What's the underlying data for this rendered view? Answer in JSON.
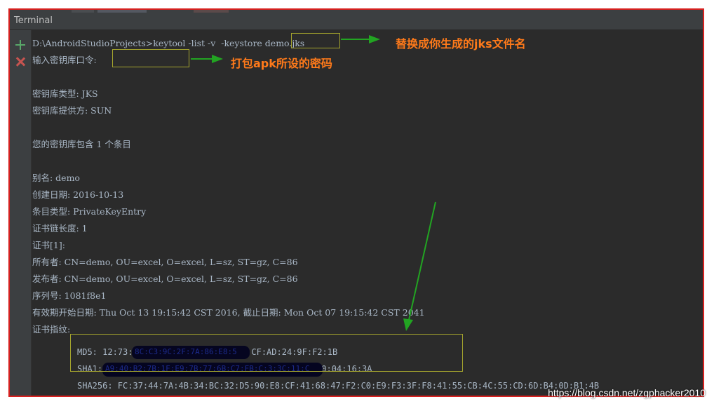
{
  "window": {
    "title": "Terminal"
  },
  "console": {
    "command_prefix": "D:\\AndroidStudioProjects>keytool -list -v  -keystore ",
    "command_file": "demo.jks",
    "password_prompt": "输入密钥库口令:",
    "keystore_type": "密钥库类型: JKS",
    "keystore_provider": "密钥库提供方: SUN",
    "entry_count": "您的密钥库包含 1 个条目",
    "alias": "别名: demo",
    "creation_date": "创建日期: 2016-10-13",
    "entry_type": "条目类型: PrivateKeyEntry",
    "chain_length": "证书链长度: 1",
    "cert_index": "证书[1]:",
    "owner": "所有者: CN=demo, OU=excel, O=excel, L=sz, ST=gz, C=86",
    "issuer": "发布者: CN=demo, OU=excel, O=excel, L=sz, ST=gz, C=86",
    "serial": "序列号: 1081f8e1",
    "validity": "有效期开始日期: Thu Oct 13 19:15:42 CST 2016, 截止日期: Mon Oct 07 19:15:42 CST 2041",
    "fingerprints_label": "证书指纹:",
    "md5_prefix": "MD5: 12:73:",
    "md5_suffix": ":54:CF:AD:24:9F:F2:1B",
    "md5_redacted": "8C:C3:9C:2F:7A:86:E8:5",
    "sha1_prefix": "SHA1:",
    "sha1_redacted": "A9:40:B2:7B:1F:E9:7B:77:6B:C7:FB:C:3:3C:11:C",
    "sha1_suffix": ":DA:E0:04:16:3A",
    "sha256": "SHA256: FC:37:44:7A:4B:34:BC:32:D5:90:E8:CF:41:68:47:F2:C0:E9:F3:3F:F8:41:55:CB:4C:55:CD:6D:B4:0D:B1:4B"
  },
  "annotations": {
    "jks_hint": "替换成你生成的jks文件名",
    "password_hint": "打包apk所设的密码"
  },
  "watermark": "https://blog.csdn.net/zgphacker2010",
  "colors": {
    "frame_border": "#d8201e",
    "terminal_bg": "#2b2b2b",
    "text": "#a9b7c6",
    "highlight_box": "#a5a52d",
    "arrow": "#22a422",
    "annotation": "#ff7a1a"
  },
  "icons": {
    "run": "plus-icon",
    "stop": "close-icon"
  }
}
